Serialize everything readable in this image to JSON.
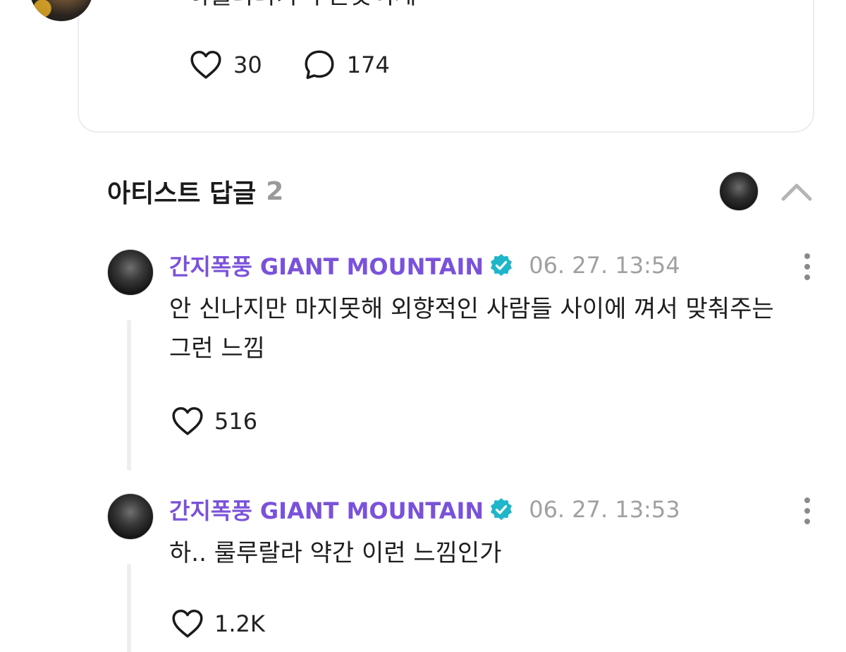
{
  "post": {
    "text": "하룰라라가 무슨뜻이게",
    "likes": "30",
    "comments": "174"
  },
  "artist_replies": {
    "title": "아티스트 답글",
    "count": "2"
  },
  "replies": [
    {
      "author": "간지폭풍 GIANT MOUNTAIN",
      "timestamp": "06. 27. 13:54",
      "text": "안 신나지만 마지못해 외향적인 사람들 사이에 껴서 맞춰주는 그런 느낌",
      "likes": "516"
    },
    {
      "author": "간지폭풍 GIANT MOUNTAIN",
      "timestamp": "06. 27. 13:53",
      "text": "하.. 룰루랄라 약간 이런 느낌인가",
      "likes": "1.2K"
    }
  ],
  "colors": {
    "author": "#7a52d9",
    "verified": "#1fb6c9",
    "muted": "#a0a0a0"
  },
  "icons": {
    "like": "heart-outline-icon",
    "comment": "speech-bubble-icon",
    "collapse": "chevron-up-icon",
    "more": "vertical-dots-icon",
    "verified": "verified-badge-icon"
  }
}
